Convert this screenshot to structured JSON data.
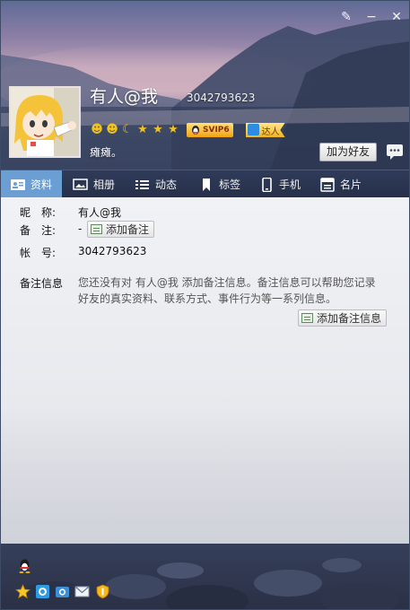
{
  "window": {
    "controls": {
      "skin": "✎",
      "minimize": "−",
      "close": "✕"
    }
  },
  "profile": {
    "nickname": "有人@我",
    "qq_number": "3042793623",
    "level_icons": [
      "sun-face",
      "sun-face",
      "moon",
      "star",
      "star",
      "star"
    ],
    "svip_label": "SVIP6",
    "daren_label": "达人",
    "signature": "瘫瘫。",
    "add_friend_label": "加为好友"
  },
  "tabs": [
    {
      "label": "资料",
      "icon": "profile-card-icon",
      "active": true
    },
    {
      "label": "相册",
      "icon": "photo-album-icon",
      "active": false
    },
    {
      "label": "动态",
      "icon": "feed-list-icon",
      "active": false
    },
    {
      "label": "标签",
      "icon": "bookmark-icon",
      "active": false
    },
    {
      "label": "手机",
      "icon": "phone-icon",
      "active": false
    },
    {
      "label": "名片",
      "icon": "card-icon",
      "active": false
    }
  ],
  "details": {
    "nickname_label": "昵　称:",
    "nickname_value": "有人@我",
    "remark_label": "备　注:",
    "remark_value": "-",
    "add_remark_label": "添加备注",
    "account_label": "帐　号:",
    "account_value": "3042793623",
    "remark_info_label": "备注信息",
    "remark_info_text": "您还没有对 有人@我 添加备注信息。备注信息可以帮助您记录好友的真实资料、联系方式、事件行为等一系列信息。",
    "add_remark_info_label": "添加备注信息"
  },
  "colors": {
    "tab_active": "#6b9fd4",
    "header_dark": "#2c374f",
    "accent_gold": "#f1a313"
  },
  "footer": {
    "icons": [
      "qq-penguin-icon",
      "favorite-star-icon",
      "qzone-icon",
      "camera-icon",
      "mail-icon",
      "shield-icon"
    ]
  }
}
